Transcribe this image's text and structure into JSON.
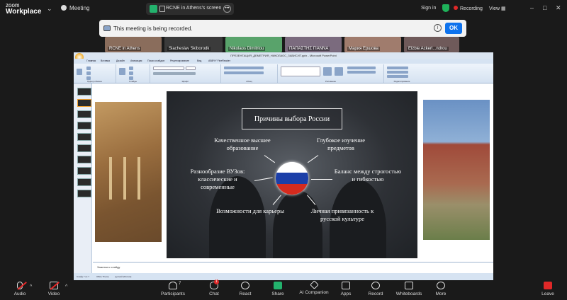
{
  "app": {
    "brand_line1": "zoom",
    "brand_line2": "Workplace",
    "meeting_label": "Meeting"
  },
  "share": {
    "label": "RCNE in Athens's screen"
  },
  "top_right": {
    "signin": "Sign in",
    "recording": "Recording",
    "view": "View"
  },
  "recording_notice": {
    "text": "This meeting is being recorded.",
    "ok": "OK"
  },
  "participants_strip": [
    {
      "name": "RCNE in Athens"
    },
    {
      "name": "Slacheslav Skiborodk"
    },
    {
      "name": "Nikolaos Dimitriou"
    },
    {
      "name": "ΠΑΠΑΣΤΗΣ ΓΙΑΝΝΑ"
    },
    {
      "name": "Мария Ершова"
    },
    {
      "name": "Elżbie Ackerl...ndrou"
    }
  ],
  "powerpoint": {
    "window_title": "ПРЕЗЕНТАЦИЯ_ДЕМЕТРИЯ_НИКОЛАОС_ЗАВИСИТ.pptx - Microsoft PowerPoint",
    "tabs": [
      "Главная",
      "Вставка",
      "Дизайн",
      "Анимация",
      "Показ слайдов",
      "Рецензирование",
      "Вид",
      "ABBYY FineReader"
    ],
    "groups": [
      "Буфер обмена",
      "Слайды",
      "Шрифт",
      "Абзац",
      "Рисование",
      "Редактирование"
    ],
    "notes_placeholder": "Заметки к слайду",
    "status": [
      "Слайд 7 из 7",
      "Office Theme",
      "русский (Россия)"
    ],
    "slide_count": 10
  },
  "slide": {
    "title": "Причины выбора России",
    "items": {
      "top_left": "Качественное высшее образование",
      "top_right": "Глубокое изучение предметов",
      "mid_left": "Разнообразие ВУЗов: классические и современные",
      "mid_right": "Баланс между строгостью и гибкостью",
      "bottom_left": "Возможности для карьеры",
      "bottom_right": "Личная привязанность к русской культуре"
    },
    "flag_colors": [
      "#ffffff",
      "#1c3fa8",
      "#d52b1e"
    ]
  },
  "toolbar": {
    "audio": "Audio",
    "video": "Video",
    "participants": "Participants",
    "participants_count": "7",
    "chat": "Chat",
    "chat_badge": "1",
    "react": "React",
    "share": "Share",
    "ai": "AI Companion",
    "apps": "Apps",
    "record": "Record",
    "whiteboards": "Whiteboards",
    "more": "More",
    "leave": "Leave"
  }
}
